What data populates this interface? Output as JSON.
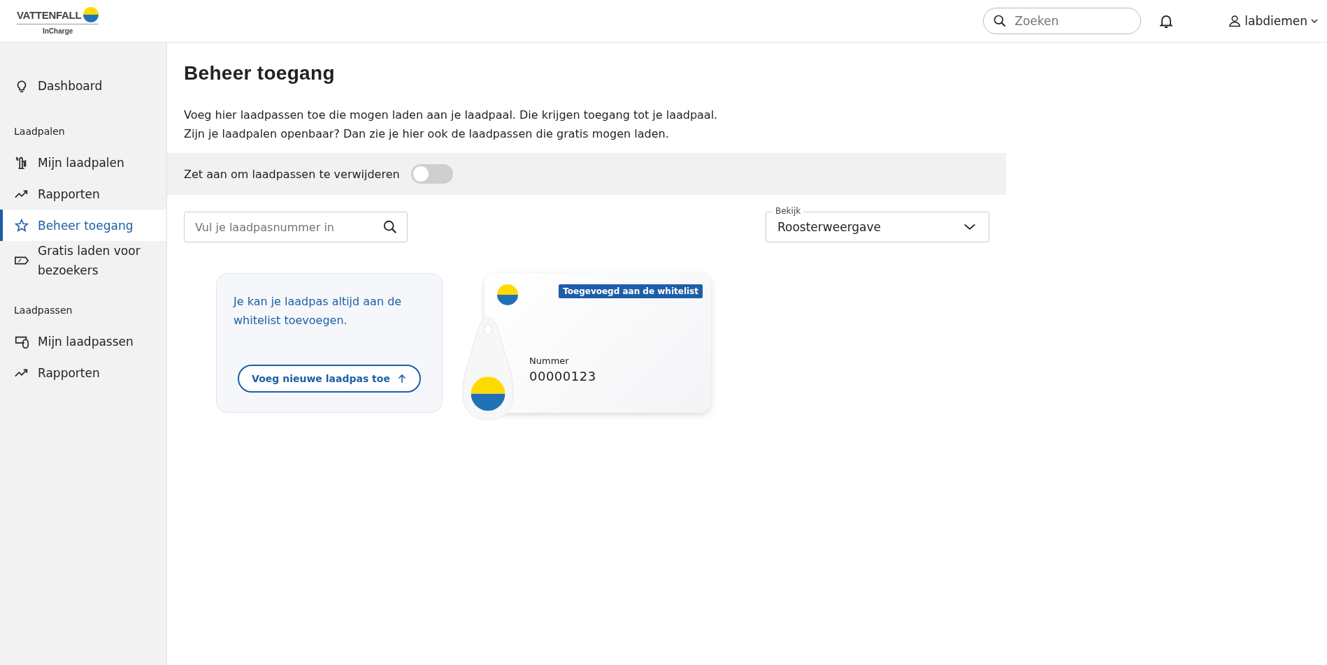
{
  "header": {
    "logo": {
      "brand": "VATTENFALL",
      "product": "InCharge"
    },
    "search": {
      "placeholder": "Zoeken"
    },
    "user": {
      "name": "labdiemen"
    }
  },
  "sidebar": {
    "sections": [
      {
        "items": [
          {
            "label": "Dashboard",
            "kind": "bulb",
            "selected": false
          }
        ]
      },
      {
        "heading": "Laadpalen",
        "items": [
          {
            "label": "Mijn laadpalen",
            "kind": "charger",
            "selected": false
          },
          {
            "label": "Rapporten",
            "kind": "trend",
            "selected": false
          },
          {
            "label": "Beheer toegang",
            "kind": "star",
            "selected": true
          },
          {
            "label": "Gratis laden voor bezoekers",
            "kind": "tag",
            "selected": false
          }
        ]
      },
      {
        "heading": "Laadpassen",
        "items": [
          {
            "label": "Mijn laadpassen",
            "kind": "cards",
            "selected": false
          },
          {
            "label": "Rapporten",
            "kind": "trend",
            "selected": false
          }
        ]
      }
    ]
  },
  "main": {
    "title": "Beheer toegang",
    "intro": [
      "Voeg hier laadpassen toe die mogen laden aan je laadpaal. Die krijgen toegang tot je laadpaal.",
      "Zijn je laadpalen openbaar? Dan zie je hier ook de laadpassen die gratis mogen laden."
    ],
    "delete_toggle": {
      "label": "Zet aan om laadpassen te verwijderen",
      "on": false
    },
    "search": {
      "placeholder": "Vul je laadpasnummer in"
    },
    "view_select": {
      "label": "Bekijk",
      "value": "Roosterweergave"
    },
    "cards": [
      {
        "kind": "add",
        "text": "Je kan je laadpas altijd aan de whitelist toevoegen.",
        "button": "Voeg nieuwe laadpas toe"
      },
      {
        "kind": "pass",
        "badge": "Toegevoegd aan de whitelist",
        "number_label": "Nummer",
        "number": "00000123"
      }
    ]
  }
}
